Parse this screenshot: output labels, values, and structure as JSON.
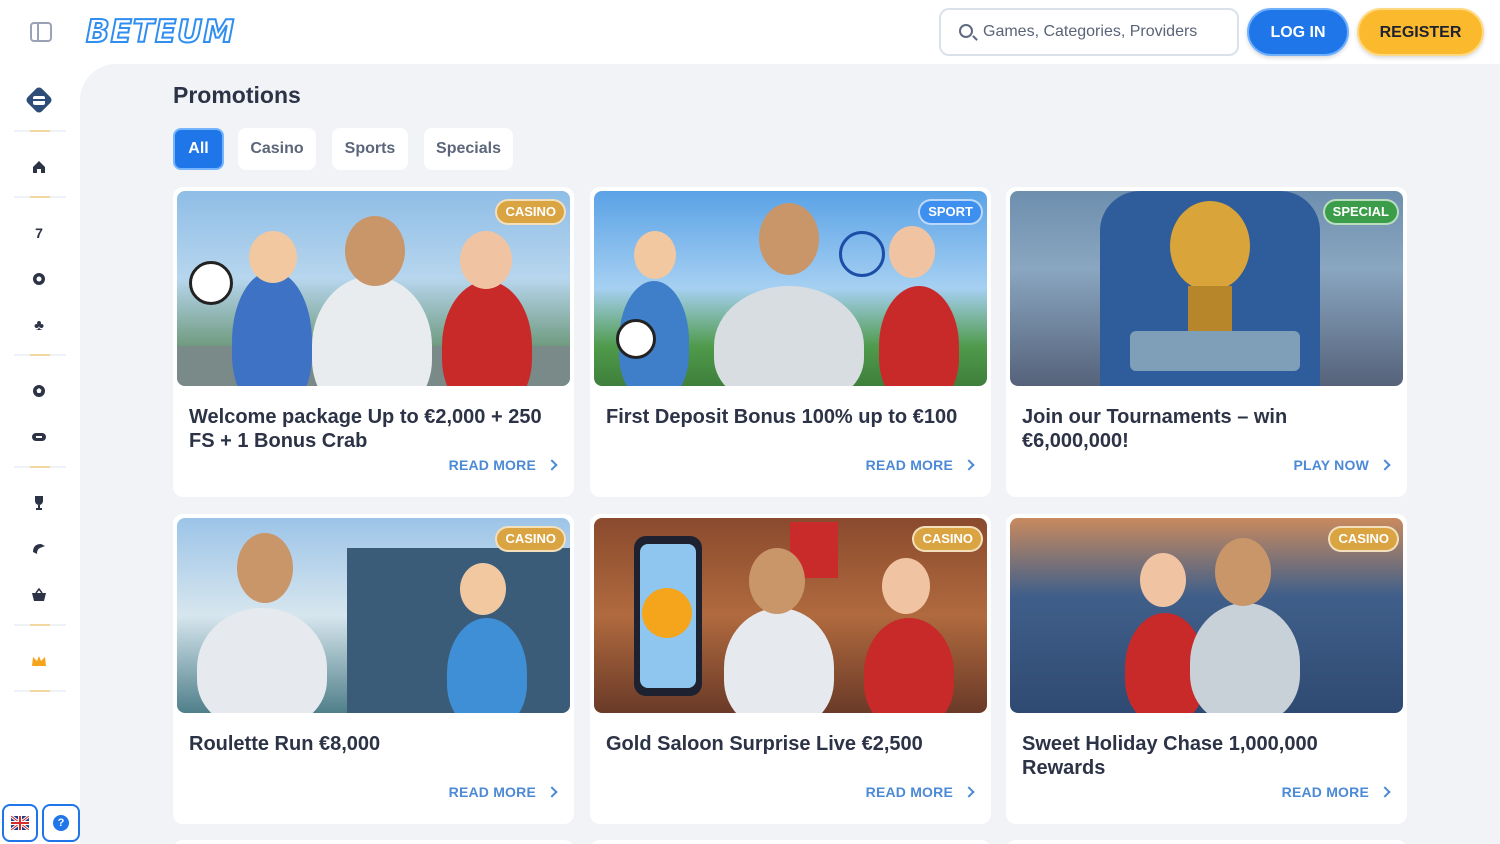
{
  "header": {
    "logo_text": "BETEUM",
    "search_placeholder": "Games, Categories, Providers",
    "login_label": "LOG IN",
    "register_label": "REGISTER"
  },
  "sidebar": {
    "items": [
      {
        "icon": "promo-diamond-icon"
      },
      {
        "icon": "home-icon"
      },
      {
        "icon": "slot-seven-icon"
      },
      {
        "icon": "roulette-icon"
      },
      {
        "icon": "cards-club-icon"
      },
      {
        "icon": "football-icon"
      },
      {
        "icon": "esports-controller-icon"
      },
      {
        "icon": "trophy-icon"
      },
      {
        "icon": "racing-icon"
      },
      {
        "icon": "shop-basket-icon"
      },
      {
        "icon": "vip-crown-icon"
      }
    ],
    "language": "UK flag",
    "help": "?"
  },
  "main": {
    "title": "Promotions",
    "tabs": [
      {
        "label": "All",
        "active": true
      },
      {
        "label": "Casino",
        "active": false
      },
      {
        "label": "Sports",
        "active": false
      },
      {
        "label": "Specials",
        "active": false
      }
    ],
    "cards": [
      {
        "badge": "CASINO",
        "badge_color": "#d9a441",
        "title": "Welcome package Up to €2,000 + 250 FS + 1 Bonus Crab",
        "link": "READ MORE"
      },
      {
        "badge": "SPORT",
        "badge_color": "#3d8ff0",
        "title": "First Deposit Bonus 100% up to €100",
        "link": "READ MORE"
      },
      {
        "badge": "SPECIAL",
        "badge_color": "#3b9d4a",
        "title": "Join our Tournaments – win €6,000,000!",
        "link": "PLAY NOW"
      },
      {
        "badge": "CASINO",
        "badge_color": "#d9a441",
        "title": "Roulette Run €8,000",
        "link": "READ MORE"
      },
      {
        "badge": "CASINO",
        "badge_color": "#d9a441",
        "title": "Gold Saloon Surprise Live €2,500",
        "link": "READ MORE"
      },
      {
        "badge": "CASINO",
        "badge_color": "#d9a441",
        "title": "Sweet Holiday Chase 1,000,000 Rewards",
        "link": "READ MORE"
      }
    ]
  },
  "colors": {
    "accent_blue": "#1e76e8",
    "register_yellow": "#fbb92e",
    "page_bg": "#f1f3f7"
  }
}
